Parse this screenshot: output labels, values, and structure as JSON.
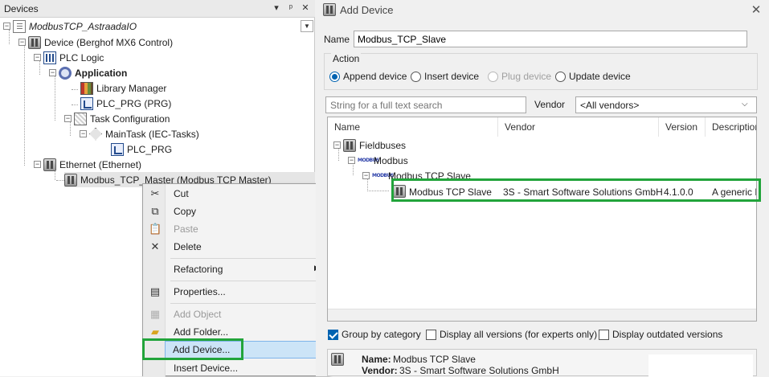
{
  "devices_panel": {
    "title": "Devices",
    "pin_icon": "pin-icon",
    "close_icon": "close-icon",
    "tree": [
      {
        "id": "project",
        "label": "ModbusTCP_AstraadaIO",
        "italic": true
      },
      {
        "id": "device",
        "label": "Device (Berghof MX6 Control)"
      },
      {
        "id": "plc",
        "label": "PLC Logic"
      },
      {
        "id": "application",
        "label": "Application",
        "bold": true
      },
      {
        "id": "library",
        "label": "Library Manager"
      },
      {
        "id": "plcprg",
        "label": "PLC_PRG (PRG)"
      },
      {
        "id": "taskconf",
        "label": "Task Configuration"
      },
      {
        "id": "maintask",
        "label": "MainTask (IEC-Tasks)"
      },
      {
        "id": "plcprg2",
        "label": "PLC_PRG"
      },
      {
        "id": "ethernet",
        "label": "Ethernet (Ethernet)"
      },
      {
        "id": "master",
        "label": "Modbus_TCP_Master (Modbus TCP Master)"
      }
    ]
  },
  "context_menu": {
    "items": [
      {
        "label": "Cut",
        "icon": "cut-icon"
      },
      {
        "label": "Copy",
        "icon": "copy-icon"
      },
      {
        "label": "Paste",
        "icon": "paste-icon",
        "disabled": true
      },
      {
        "label": "Delete",
        "icon": "delete-icon"
      },
      {
        "label": "Refactoring",
        "submenu": true
      },
      {
        "label": "Properties...",
        "icon": "properties-icon"
      },
      {
        "label": "Add Object",
        "icon": "add-object-icon",
        "disabled": true
      },
      {
        "label": "Add Folder...",
        "icon": "folder-icon"
      },
      {
        "label": "Add Device...",
        "highlighted": true
      },
      {
        "label": "Insert Device..."
      }
    ]
  },
  "add_device": {
    "title": "Add Device",
    "name_label": "Name",
    "name_value": "Modbus_TCP_Slave",
    "action_label": "Action",
    "actions": [
      {
        "label": "Append device",
        "selected": true
      },
      {
        "label": "Insert device",
        "selected": false
      },
      {
        "label": "Plug device",
        "disabled": true
      },
      {
        "label": "Update device",
        "selected": false
      }
    ],
    "search_placeholder": "String for a full text search",
    "vendor_label": "Vendor",
    "vendor_value": "<All vendors>",
    "columns": [
      "Name",
      "Vendor",
      "Version",
      "Description"
    ],
    "tree": {
      "fieldbuses": "Fieldbuses",
      "modbus": "Modbus",
      "modbus_icon_text": "MODBUS",
      "tcp_slave_group": "Modbus TCP Slave",
      "row": {
        "name": "Modbus TCP Slave",
        "vendor": "3S - Smart Software Solutions GmbH",
        "version": "4.1.0.0",
        "description": "A generic M"
      }
    },
    "options": [
      {
        "label": "Group by category",
        "checked": true
      },
      {
        "label": "Display all versions (for experts only)",
        "checked": false
      },
      {
        "label": "Display outdated versions",
        "checked": false
      }
    ],
    "info": {
      "name_key": "Name:",
      "name_val": "Modbus TCP Slave",
      "vendor_key": "Vendor:",
      "vendor_val": "3S - Smart Software Solutions GmbH"
    }
  },
  "colors": {
    "highlight_box": "#22a43b",
    "menu_highlight": "#cce4f7",
    "radio_accent": "#0063b1"
  }
}
